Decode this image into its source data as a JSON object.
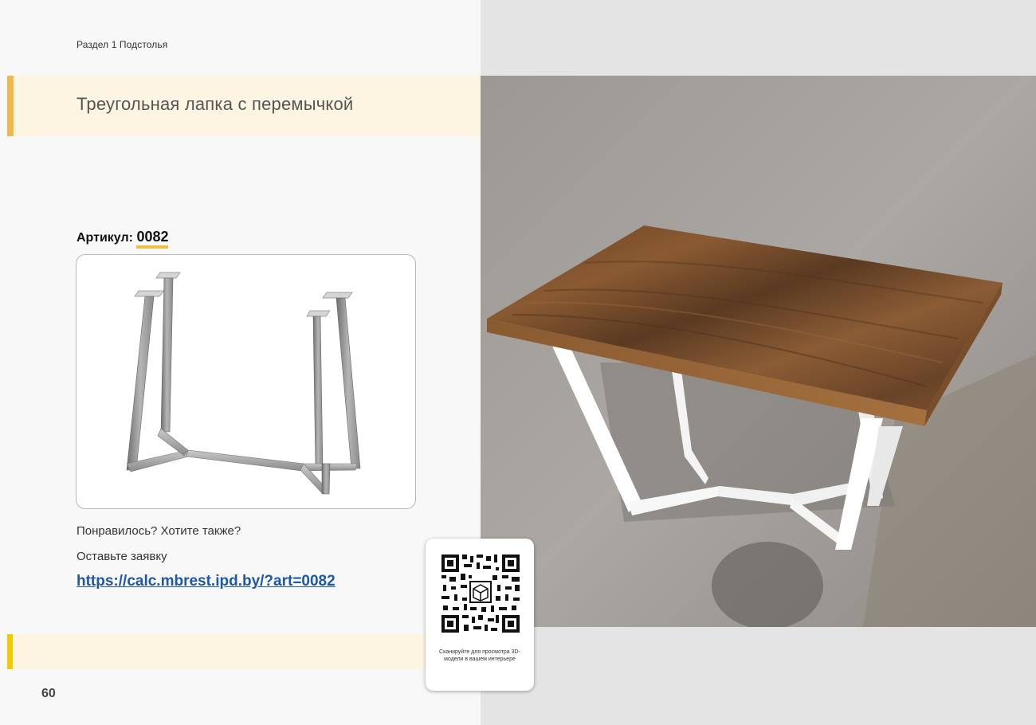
{
  "header": {
    "section_label": "Раздел 1 Подстолья",
    "title": "Треугольная лапка с перемычкой"
  },
  "article": {
    "label": "Артикул:",
    "code": "0082"
  },
  "cta": {
    "line1": "Понравилось? Хотите также?",
    "line2": "Оставьте заявку",
    "link": "https://calc.mbrest.ipd.by/?art=0082"
  },
  "qr": {
    "caption": "Сканируйте для просмотра 3D-модели в вашем интерьере"
  },
  "footer": {
    "page_number": "60"
  },
  "colors": {
    "accent_orange": "#f2b74c",
    "accent_yellow": "#f6c800",
    "band": "#fdf5e2",
    "link": "#1f58a6"
  }
}
